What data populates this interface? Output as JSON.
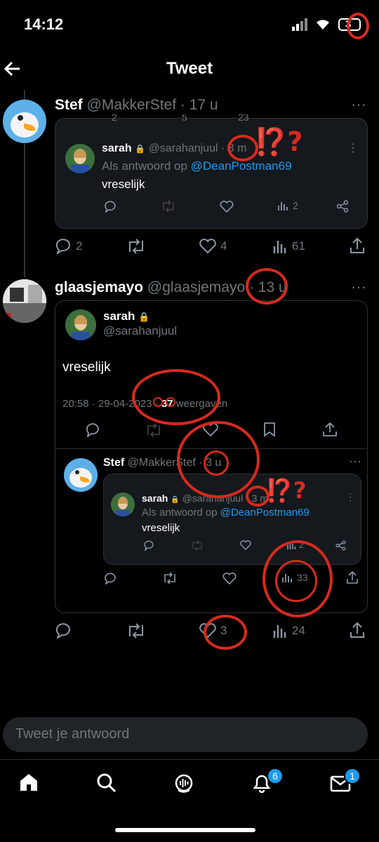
{
  "status_bar": {
    "time": "14:12",
    "battery": "3"
  },
  "header": {
    "title": "Tweet"
  },
  "tweet1": {
    "name": "Stef",
    "handle": "@MakkerStef",
    "time": "· 17 u",
    "quote_top_counts": {
      "replies": "2",
      "retweets": "5",
      "likes": "23"
    },
    "quote": {
      "name": "sarah",
      "handle": "@sarahanjuul",
      "time": "· 3 m",
      "reply_prefix": "Als antwoord op",
      "reply_mention": "@DeanPostman69",
      "text": "vreselijk",
      "views": "2"
    },
    "actions": {
      "replies": "2",
      "likes": "4",
      "views": "61"
    }
  },
  "tweet2": {
    "name": "glaasjemayo",
    "handle": "@glaasjemayo",
    "time": "· 13 u",
    "quote": {
      "name": "sarah",
      "handle": "@sarahanjuul",
      "text": "vreselijk",
      "timestamp": "20:58 · 29-04-2023 ·",
      "views_count": "37",
      "views_label": "weergaven",
      "inner": {
        "name": "Stef",
        "handle": "@MakkerStef",
        "time": "· 3 u",
        "quote": {
          "name": "sarah",
          "handle": "@sarahanjuul",
          "time": "· 3 m",
          "reply_prefix": "Als antwoord op",
          "reply_mention": "@DeanPostman69",
          "text": "vreselijk",
          "views": "2"
        },
        "views": "33"
      }
    },
    "actions": {
      "likes": "3",
      "views": "24"
    }
  },
  "annotations": {
    "mark1": "⁉️?",
    "mark2": "⁉️?",
    "mark3": "3"
  },
  "reply_input": {
    "placeholder": "Tweet je antwoord"
  },
  "tab_bar": {
    "notifications_badge": "6",
    "messages_badge": "1"
  }
}
